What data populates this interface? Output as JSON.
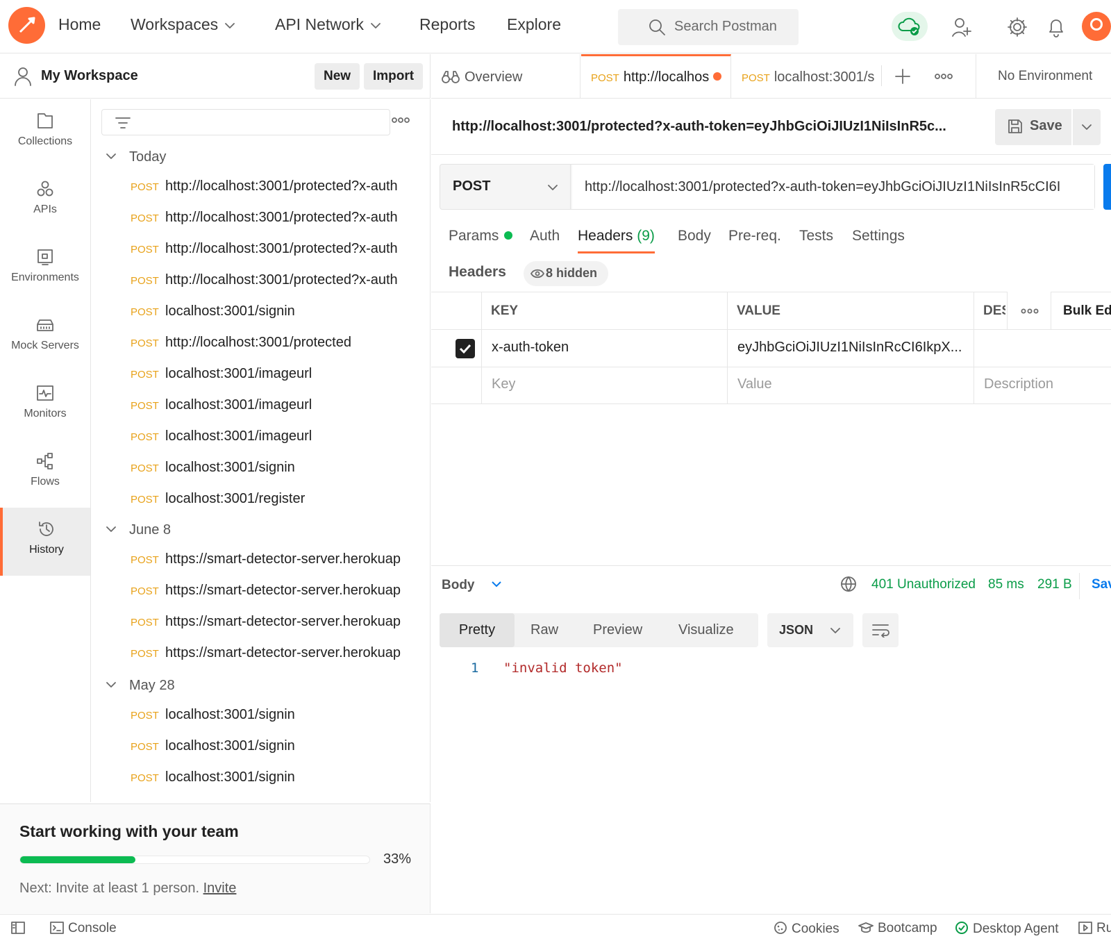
{
  "nav": {
    "items": [
      {
        "label": "Home",
        "dropdown": false
      },
      {
        "label": "Workspaces",
        "dropdown": true
      },
      {
        "label": "API Network",
        "dropdown": true
      },
      {
        "label": "Reports",
        "dropdown": false
      },
      {
        "label": "Explore",
        "dropdown": false
      }
    ],
    "search_placeholder": "Search Postman",
    "icons": [
      "postman-logo-icon",
      "cloud-sync-icon",
      "invite-user-icon",
      "gear-icon",
      "bell-icon",
      "avatar"
    ]
  },
  "workspace": {
    "name": "My Workspace",
    "new_label": "New",
    "import_label": "Import"
  },
  "rail": {
    "items": [
      {
        "label": "Collections",
        "icon": "collections-icon",
        "active": false
      },
      {
        "label": "APIs",
        "icon": "apis-icon",
        "active": false
      },
      {
        "label": "Environments",
        "icon": "environments-icon",
        "active": false
      },
      {
        "label": "Mock Servers",
        "icon": "mock-servers-icon",
        "active": false
      },
      {
        "label": "Monitors",
        "icon": "monitors-icon",
        "active": false
      },
      {
        "label": "Flows",
        "icon": "flows-icon",
        "active": false
      },
      {
        "label": "History",
        "icon": "history-icon",
        "active": true
      }
    ]
  },
  "history": {
    "groups": [
      {
        "label": "Today",
        "items": [
          {
            "method": "POST",
            "url": "http://localhost:3001/protected?x-auth"
          },
          {
            "method": "POST",
            "url": "http://localhost:3001/protected?x-auth"
          },
          {
            "method": "POST",
            "url": "http://localhost:3001/protected?x-auth"
          },
          {
            "method": "POST",
            "url": "http://localhost:3001/protected?x-auth"
          },
          {
            "method": "POST",
            "url": "localhost:3001/signin"
          },
          {
            "method": "POST",
            "url": "http://localhost:3001/protected"
          },
          {
            "method": "POST",
            "url": "localhost:3001/imageurl"
          },
          {
            "method": "POST",
            "url": "localhost:3001/imageurl"
          },
          {
            "method": "POST",
            "url": "localhost:3001/imageurl"
          },
          {
            "method": "POST",
            "url": "localhost:3001/signin"
          },
          {
            "method": "POST",
            "url": "localhost:3001/register"
          }
        ]
      },
      {
        "label": "June 8",
        "items": [
          {
            "method": "POST",
            "url": "https://smart-detector-server.herokuap"
          },
          {
            "method": "POST",
            "url": "https://smart-detector-server.herokuap"
          },
          {
            "method": "POST",
            "url": "https://smart-detector-server.herokuap"
          },
          {
            "method": "POST",
            "url": "https://smart-detector-server.herokuap"
          }
        ]
      },
      {
        "label": "May 28",
        "items": [
          {
            "method": "POST",
            "url": "localhost:3001/signin"
          },
          {
            "method": "POST",
            "url": "localhost:3001/signin"
          },
          {
            "method": "POST",
            "url": "localhost:3001/signin"
          }
        ]
      }
    ]
  },
  "team": {
    "title": "Start working with your team",
    "progress_percent": 33,
    "progress_label": "33%",
    "next_text": "Next: Invite at least 1 person.",
    "invite_label": "Invite"
  },
  "statusbar": {
    "console_label": "Console",
    "cookies_label": "Cookies",
    "bootcamp_label": "Bootcamp",
    "agent_label": "Desktop Agent",
    "runner_label": "Ru"
  },
  "tabs": {
    "overview_label": "Overview",
    "tab1": {
      "method": "POST",
      "title": "http://localhos",
      "unsaved": true
    },
    "tab2": {
      "method": "POST",
      "title": "localhost:3001/s"
    },
    "environment_label": "No Environment"
  },
  "request": {
    "title": "http://localhost:3001/protected?x-auth-token=eyJhbGciOiJIUzI1NiIsInR5c...",
    "save_label": "Save",
    "method": "POST",
    "url": "http://localhost:3001/protected?x-auth-token=eyJhbGciOiJIUzI1NiIsInR5cCI6I",
    "tabs": {
      "params": "Params",
      "auth": "Auth",
      "headers": "Headers",
      "headers_count": "(9)",
      "body": "Body",
      "prereq": "Pre-req.",
      "tests": "Tests",
      "settings": "Settings"
    },
    "headers_label": "Headers",
    "hidden_label": "8 hidden",
    "columns": {
      "key": "KEY",
      "value": "VALUE",
      "description": "DES",
      "bulk_edit": "Bulk Ed"
    },
    "rows": [
      {
        "checked": true,
        "key": "x-auth-token",
        "value": "eyJhbGciOiJIUzI1NiIsInRcCI6IkpX..."
      }
    ],
    "placeholders": {
      "key": "Key",
      "value": "Value",
      "description": "Description"
    }
  },
  "response": {
    "body_label": "Body",
    "status": "401 Unauthorized",
    "time": "85 ms",
    "size": "291 B",
    "save_label": "Sav",
    "views": [
      "Pretty",
      "Raw",
      "Preview",
      "Visualize"
    ],
    "active_view": "Pretty",
    "format": "JSON",
    "lines": [
      {
        "num": "1",
        "text": "\"invalid token\""
      }
    ]
  },
  "colors": {
    "brand": "#ff6c37",
    "method_post": "#e8a21a",
    "status_green": "#0a9c48",
    "send_blue": "#097bed"
  }
}
